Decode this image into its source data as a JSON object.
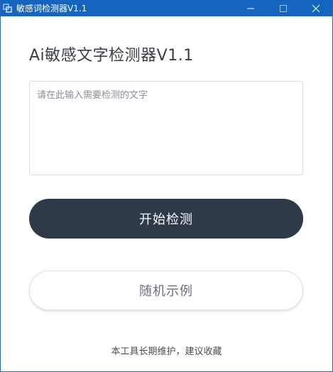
{
  "window": {
    "title": "敏感词检测器V1.1",
    "controls": {
      "minimize": "—",
      "maximize": "☐",
      "close": "✕"
    }
  },
  "main": {
    "heading": "Ai敏感文字检测器V1.1",
    "input": {
      "value": "",
      "placeholder": "请在此输入需要检测的文字"
    },
    "start_button": "开始检测",
    "random_button": "随机示例",
    "footer": "本工具长期维护，建议收藏"
  },
  "colors": {
    "titlebar": "#1565c0",
    "primary_button": "#2e3a48",
    "heading_text": "#3a3f47"
  }
}
